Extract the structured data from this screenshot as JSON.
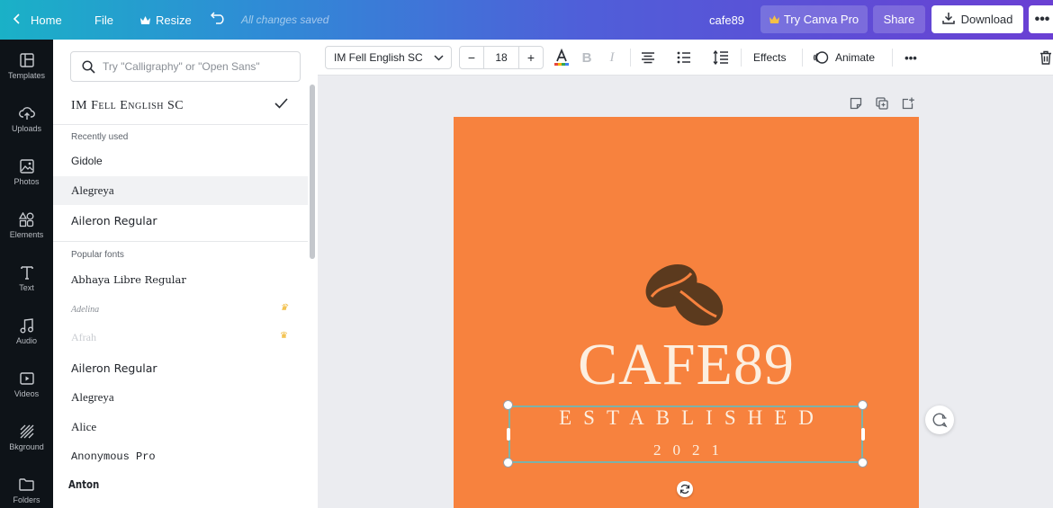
{
  "topbar": {
    "home_label": "Home",
    "file_label": "File",
    "resize_label": "Resize",
    "status_text": "All changes saved",
    "doc_name": "cafe89",
    "try_pro_label": "Try Canva Pro",
    "share_label": "Share",
    "download_label": "Download",
    "gradient_start": "#1ab1c7",
    "gradient_end": "#6a3fd3"
  },
  "sidebar": {
    "items": [
      {
        "label": "Templates",
        "icon": "templates-icon"
      },
      {
        "label": "Uploads",
        "icon": "uploads-icon"
      },
      {
        "label": "Photos",
        "icon": "photos-icon"
      },
      {
        "label": "Elements",
        "icon": "elements-icon"
      },
      {
        "label": "Text",
        "icon": "text-icon"
      },
      {
        "label": "Audio",
        "icon": "audio-icon"
      },
      {
        "label": "Videos",
        "icon": "videos-icon"
      },
      {
        "label": "Bkground",
        "icon": "background-icon"
      },
      {
        "label": "Folders",
        "icon": "folders-icon"
      }
    ]
  },
  "font_panel": {
    "search_placeholder": "Try \"Calligraphy\" or \"Open Sans\"",
    "selected_font": "IM Fell English SC",
    "recently_used_label": "Recently used",
    "recently_used": [
      "Gidole",
      "Alegreya",
      "Aileron Regular"
    ],
    "popular_label": "Popular fonts",
    "popular": [
      {
        "name": "Abhaya Libre Regular",
        "pro": false
      },
      {
        "name": "Adelina",
        "pro": true
      },
      {
        "name": "Afrah",
        "pro": true
      },
      {
        "name": "Aileron Regular",
        "pro": false
      },
      {
        "name": "Alegreya",
        "pro": false
      },
      {
        "name": "Alice",
        "pro": false
      },
      {
        "name": "Anonymous Pro",
        "pro": false
      },
      {
        "name": "Anton",
        "pro": false
      }
    ]
  },
  "toolbar": {
    "font_name": "IM Fell English SC",
    "font_size": "18",
    "minus_label": "−",
    "plus_label": "+",
    "bold_label": "B",
    "italic_label": "I",
    "effects_label": "Effects",
    "animate_label": "Animate",
    "text_color": "#000000"
  },
  "design": {
    "background": "#f7823e",
    "title": "CAFE89",
    "subtitle": "ESTABLISHED",
    "year": "2021",
    "text_color": "#fcefe0",
    "bean_color": "#5b3a1e"
  }
}
